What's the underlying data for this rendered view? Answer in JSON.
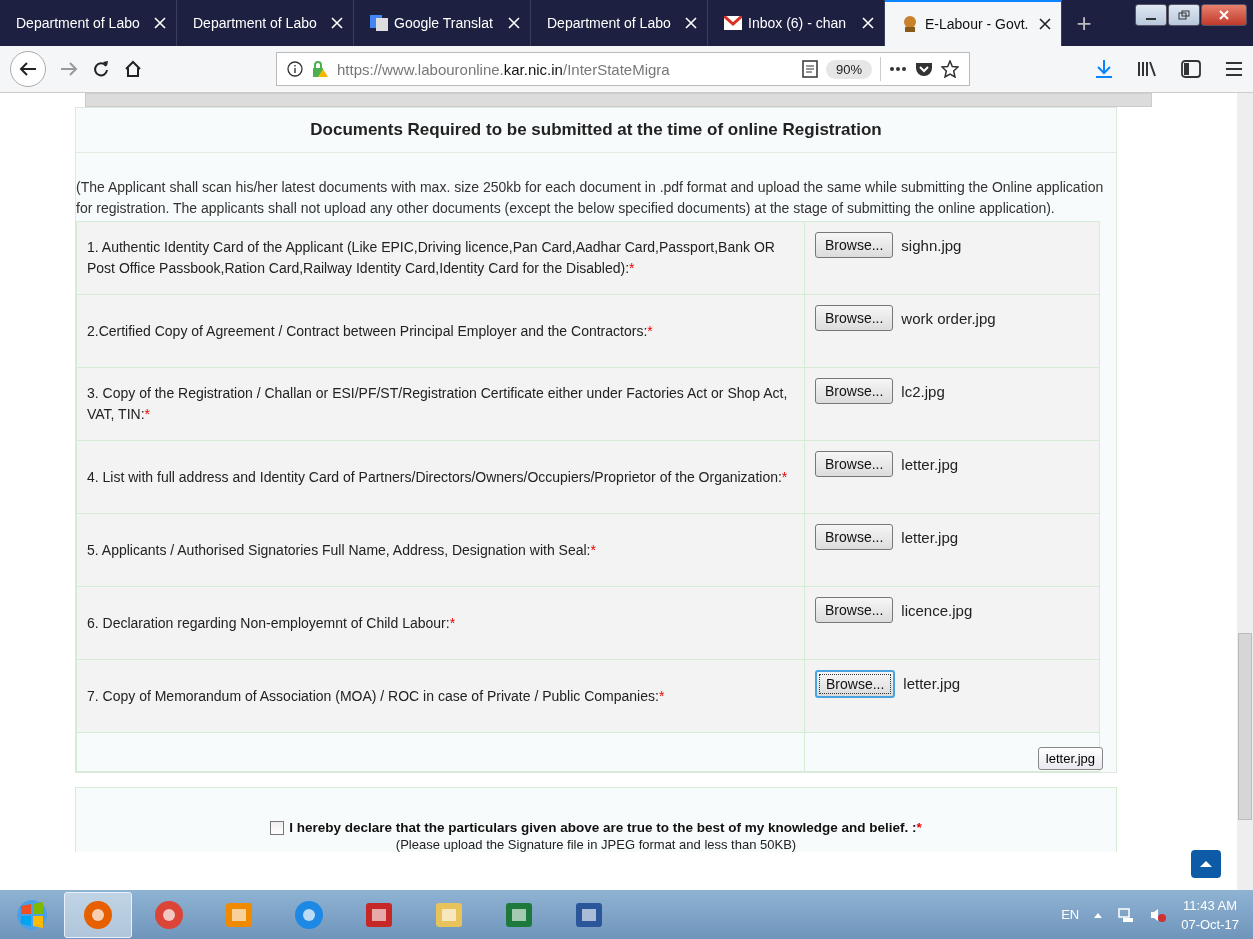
{
  "tabs": [
    {
      "title": "Department of Labo",
      "selected": false
    },
    {
      "title": "Department of Labo",
      "selected": false
    },
    {
      "title": "Google Translat",
      "selected": false
    },
    {
      "title": "Department of Labo",
      "selected": false
    },
    {
      "title": "Inbox (6) - chan",
      "selected": false
    },
    {
      "title": "E-Labour - Govt.",
      "selected": true
    }
  ],
  "new_tab": "+",
  "url": {
    "prefix": "https://www.labouronline.",
    "domain": "kar.nic.in",
    "path": "/InterStateMigra"
  },
  "zoom": "90%",
  "page": {
    "heading": "Documents Required to be submitted at the time of online Registration",
    "intro": "(The Applicant shall scan his/her latest documents with max. size 250kb for each document in .pdf format and upload the same while submitting the Online application for registration. The applicants shall not upload any other documents (except the below specified documents) at the stage of submitting the online application).",
    "documents": [
      {
        "label": "1. Authentic Identity Card of the Applicant (Like EPIC,Driving licence,Pan Card,Aadhar Card,Passport,Bank OR Post Office Passbook,Ration Card,Railway Identity Card,Identity Card for the Disabled):",
        "required": "*",
        "button": "Browse...",
        "file": "sighn.jpg",
        "focused": false
      },
      {
        "label": "2.Certified Copy of Agreement / Contract between Principal Employer and the Contractors:",
        "required": "*",
        "button": "Browse...",
        "file": "work order.jpg",
        "focused": false
      },
      {
        "label": "3. Copy of the Registration / Challan or ESI/PF/ST/Registration Certificate either under Factories Act or Shop Act, VAT, TIN:",
        "required": "*",
        "button": "Browse...",
        "file": "lc2.jpg",
        "focused": false
      },
      {
        "label": "4. List with full address and Identity Card of Partners/Directors/Owners/Occupiers/Proprietor of the Organization:",
        "required": "*",
        "button": "Browse...",
        "file": "letter.jpg",
        "focused": false
      },
      {
        "label": "5. Applicants / Authorised Signatories Full Name, Address, Designation with Seal:",
        "required": "*",
        "button": "Browse...",
        "file": "letter.jpg",
        "focused": false
      },
      {
        "label": "6. Declaration regarding Non-employemnt of Child Labour:",
        "required": "*",
        "button": "Browse...",
        "file": "licence.jpg",
        "focused": false
      },
      {
        "label": "7. Copy of Memorandum of Association (MOA) / ROC in case of Private / Public Companies:",
        "required": "*",
        "button": "Browse...",
        "file": "letter.jpg",
        "focused": true
      }
    ],
    "tooltip": "letter.jpg",
    "declaration": {
      "text": "I hereby declare that the particulars given above are true to the best of my knowledge and belief. :",
      "required": "*",
      "checked": false,
      "note": "(Please upload the Signature file in JPEG format and less than 50KB)"
    }
  },
  "taskbar": {
    "apps": [
      {
        "selected": true
      },
      {
        "selected": false
      },
      {
        "selected": false
      },
      {
        "selected": false
      },
      {
        "selected": false
      },
      {
        "selected": false
      },
      {
        "selected": false
      },
      {
        "selected": false
      }
    ],
    "language": "EN",
    "time": "11:43 AM",
    "date": "07-Oct-17"
  }
}
